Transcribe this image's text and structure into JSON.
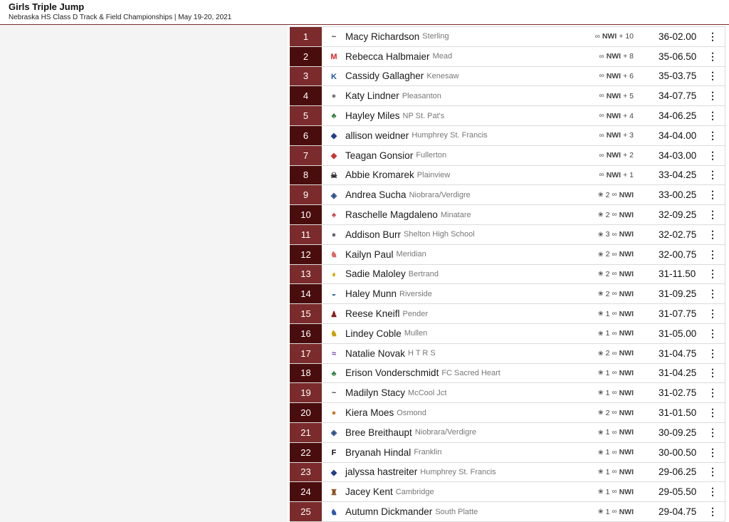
{
  "header": {
    "title": "Girls Triple Jump",
    "subtitle": "Nebraska HS Class D Track & Field Championships | May 19-20, 2021"
  },
  "colors": {
    "place_odd": "#7b2b2b",
    "place_even": "#4a0d0d",
    "accent": "#7a2a2a"
  },
  "results": [
    {
      "place": "1",
      "name": "Macy Richardson",
      "school": "Sterling",
      "meta_icon": "wind-icon",
      "badge": "NWI",
      "detail": "+ 10",
      "mark": "36-02.00",
      "logo_char": "~",
      "logo_color": "#333"
    },
    {
      "place": "2",
      "name": "Rebecca Halbmaier",
      "school": "Mead",
      "meta_icon": "wind-icon",
      "badge": "NWI",
      "detail": "+ 8",
      "mark": "35-06.50",
      "logo_char": "M",
      "logo_color": "#d22"
    },
    {
      "place": "3",
      "name": "Cassidy Gallagher",
      "school": "Kenesaw",
      "meta_icon": "wind-icon",
      "badge": "NWI",
      "detail": "+ 6",
      "mark": "35-03.75",
      "logo_char": "K",
      "logo_color": "#1f56a8"
    },
    {
      "place": "4",
      "name": "Katy Lindner",
      "school": "Pleasanton",
      "meta_icon": "wind-icon",
      "badge": "NWI",
      "detail": "+ 5",
      "mark": "34-07.75",
      "logo_char": "●",
      "logo_color": "#777"
    },
    {
      "place": "5",
      "name": "Hayley Miles",
      "school": "NP St. Pat's",
      "meta_icon": "wind-icon",
      "badge": "NWI",
      "detail": "+ 4",
      "mark": "34-06.25",
      "logo_char": "♣",
      "logo_color": "#2a7a3a"
    },
    {
      "place": "6",
      "name": "allison weidner",
      "school": "Humphrey St. Francis",
      "meta_icon": "wind-icon",
      "badge": "NWI",
      "detail": "+ 3",
      "mark": "34-04.00",
      "logo_char": "◆",
      "logo_color": "#1f3d8a"
    },
    {
      "place": "7",
      "name": "Teagan Gonsior",
      "school": "Fullerton",
      "meta_icon": "wind-icon",
      "badge": "NWI",
      "detail": "+ 2",
      "mark": "34-03.00",
      "logo_char": "◆",
      "logo_color": "#c33"
    },
    {
      "place": "8",
      "name": "Abbie Kromarek",
      "school": "Plainview",
      "meta_icon": "wind-icon",
      "badge": "NWI",
      "detail": "+ 1",
      "mark": "33-04.25",
      "logo_char": "☠",
      "logo_color": "#222"
    },
    {
      "place": "9",
      "name": "Andrea Sucha",
      "school": "Niobrara/Verdigre",
      "meta_icon": "flame-icon",
      "badge": "NWI",
      "detail": "2",
      "mark": "33-00.25",
      "logo_char": "◈",
      "logo_color": "#2a4e8a"
    },
    {
      "place": "10",
      "name": "Raschelle Magdaleno",
      "school": "Minatare",
      "meta_icon": "flame-icon",
      "badge": "NWI",
      "detail": "2",
      "mark": "32-09.25",
      "logo_char": "♠",
      "logo_color": "#c33"
    },
    {
      "place": "11",
      "name": "Addison Burr",
      "school": "Shelton High School",
      "meta_icon": "flame-icon",
      "badge": "NWI",
      "detail": "3",
      "mark": "32-02.75",
      "logo_char": "●",
      "logo_color": "#667"
    },
    {
      "place": "12",
      "name": "Kailyn Paul",
      "school": "Meridian",
      "meta_icon": "flame-icon",
      "badge": "NWI",
      "detail": "2",
      "mark": "32-00.75",
      "logo_char": "♞",
      "logo_color": "#d66"
    },
    {
      "place": "13",
      "name": "Sadie Maloley",
      "school": "Bertrand",
      "meta_icon": "flame-icon",
      "badge": "NWI",
      "detail": "2",
      "mark": "31-11.50",
      "logo_char": "♦",
      "logo_color": "#d9a700"
    },
    {
      "place": "14",
      "name": "Haley Munn",
      "school": "Riverside",
      "meta_icon": "flame-icon",
      "badge": "NWI",
      "detail": "2",
      "mark": "31-09.25",
      "logo_char": "◒",
      "logo_color": "#2a6aa8"
    },
    {
      "place": "15",
      "name": "Reese Kneifl",
      "school": "Pender",
      "meta_icon": "flame-icon",
      "badge": "NWI",
      "detail": "1",
      "mark": "31-07.75",
      "logo_char": "♟",
      "logo_color": "#8a1a1a"
    },
    {
      "place": "16",
      "name": "Lindey Coble",
      "school": "Mullen",
      "meta_icon": "flame-icon",
      "badge": "NWI",
      "detail": "1",
      "mark": "31-05.00",
      "logo_char": "♞",
      "logo_color": "#c9a200"
    },
    {
      "place": "17",
      "name": "Natalie Novak",
      "school": "H T R S",
      "meta_icon": "flame-icon",
      "badge": "NWI",
      "detail": "2",
      "mark": "31-04.75",
      "logo_char": "≈",
      "logo_color": "#6b3fa8"
    },
    {
      "place": "18",
      "name": "Erison Vonderschmidt",
      "school": "FC Sacred Heart",
      "meta_icon": "flame-icon",
      "badge": "NWI",
      "detail": "1",
      "mark": "31-04.25",
      "logo_char": "♣",
      "logo_color": "#2a7a3a"
    },
    {
      "place": "19",
      "name": "Madilyn Stacy",
      "school": "McCool Jct",
      "meta_icon": "flame-icon",
      "badge": "NWI",
      "detail": "1",
      "mark": "31-02.75",
      "logo_char": "~",
      "logo_color": "#333"
    },
    {
      "place": "20",
      "name": "Kiera Moes",
      "school": "Osmond",
      "meta_icon": "flame-icon",
      "badge": "NWI",
      "detail": "2",
      "mark": "31-01.50",
      "logo_char": "●",
      "logo_color": "#c8782a"
    },
    {
      "place": "21",
      "name": "Bree Breithaupt",
      "school": "Niobrara/Verdigre",
      "meta_icon": "flame-icon",
      "badge": "NWI",
      "detail": "1",
      "mark": "30-09.25",
      "logo_char": "◈",
      "logo_color": "#2a4e8a"
    },
    {
      "place": "22",
      "name": "Bryanah Hindal",
      "school": "Franklin",
      "meta_icon": "flame-icon",
      "badge": "NWI",
      "detail": "1",
      "mark": "30-00.50",
      "logo_char": "F",
      "logo_color": "#111"
    },
    {
      "place": "23",
      "name": "jalyssa hastreiter",
      "school": "Humphrey St. Francis",
      "meta_icon": "flame-icon",
      "badge": "NWI",
      "detail": "1",
      "mark": "29-06.25",
      "logo_char": "◆",
      "logo_color": "#1f3d8a"
    },
    {
      "place": "24",
      "name": "Jacey Kent",
      "school": "Cambridge",
      "meta_icon": "flame-icon",
      "badge": "NWI",
      "detail": "1",
      "mark": "29-05.50",
      "logo_char": "♜",
      "logo_color": "#8a4a1a"
    },
    {
      "place": "25",
      "name": "Autumn Dickmander",
      "school": "South Platte",
      "meta_icon": "flame-icon",
      "badge": "NWI",
      "detail": "1",
      "mark": "29-04.75",
      "logo_char": "♞",
      "logo_color": "#2a5aa8"
    }
  ],
  "menu_glyph": "⋮"
}
